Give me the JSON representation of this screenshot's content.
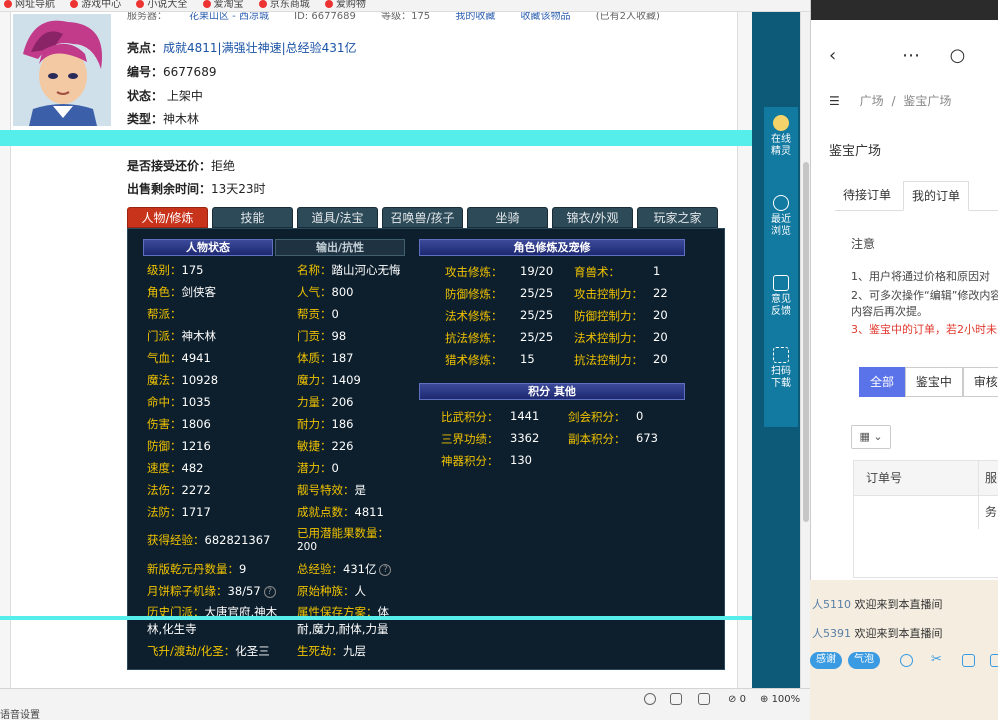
{
  "favbar": [
    "网址导航",
    "游戏中心",
    "小说大全",
    "爱淘宝",
    "京东商城",
    "爱购物"
  ],
  "subheader": {
    "left": "服务器：",
    "server": "花果山区 - 西凉城",
    "id_hint": "ID: 6677689",
    "level_hint": "等级：175",
    "link1": "我的收藏",
    "link2": "收藏该物品",
    "right": "(已有2人收藏)"
  },
  "info": {
    "highlight_label": "亮点：",
    "highlight_value": "成就4811|满强壮神速|总经验431亿",
    "id_label": "编号：",
    "id_value": "6677689",
    "status_label": "状态：",
    "status_value": "上架中",
    "type_label": "类型：",
    "type_value": "神木林",
    "bargain_label": "是否接受还价：",
    "bargain_value": "拒绝",
    "time_label": "出售剩余时间：",
    "time_value": "13天23时"
  },
  "tabs": [
    "人物/修炼",
    "技能",
    "道具/法宝",
    "召唤兽/孩子",
    "坐骑",
    "锦衣/外观",
    "玩家之家"
  ],
  "sections": {
    "char_status": "人物状态",
    "output": "输出/抗性",
    "cultivation": "角色修炼及宠修",
    "points": "积分 其他"
  },
  "left_stats": [
    {
      "k": "级别：",
      "v": "175"
    },
    {
      "k": "角色：",
      "v": "剑侠客"
    },
    {
      "k": "帮派：",
      "v": ""
    },
    {
      "k": "门派：",
      "v": "神木林"
    },
    {
      "k": "气血：",
      "v": "4941"
    },
    {
      "k": "魔法：",
      "v": "10928"
    },
    {
      "k": "命中：",
      "v": "1035"
    },
    {
      "k": "伤害：",
      "v": "1806"
    },
    {
      "k": "防御：",
      "v": "1216"
    },
    {
      "k": "速度：",
      "v": "482"
    },
    {
      "k": "法伤：",
      "v": "2272"
    },
    {
      "k": "法防：",
      "v": "1717"
    },
    {
      "k": "获得经验：",
      "v": "682821367"
    },
    {
      "k": "新版乾元丹数量：",
      "v": "9"
    },
    {
      "k": "月饼粽子机缘：",
      "v": "38/57"
    }
  ],
  "mid_stats": [
    {
      "k": "名称：",
      "v": "踏山河心无悔"
    },
    {
      "k": "人气：",
      "v": "800"
    },
    {
      "k": "帮贡：",
      "v": "0"
    },
    {
      "k": "门贡：",
      "v": "98"
    },
    {
      "k": "体质：",
      "v": "187"
    },
    {
      "k": "魔力：",
      "v": "1409"
    },
    {
      "k": "力量：",
      "v": "206"
    },
    {
      "k": "耐力：",
      "v": "186"
    },
    {
      "k": "敏捷：",
      "v": "226"
    },
    {
      "k": "潜力：",
      "v": "0"
    },
    {
      "k": "靓号特效：",
      "v": "是"
    },
    {
      "k": "成就点数：",
      "v": "4811"
    },
    {
      "k": "已用潜能果数量：",
      "v": "200"
    },
    {
      "k": "总经验：",
      "v": "431亿"
    },
    {
      "k": "原始种族：",
      "v": "人"
    }
  ],
  "history": {
    "k": "历史门派：",
    "v1": "大唐官府,神木",
    "v2": "林,化生寺"
  },
  "attr_keep": {
    "k": "属性保存方案：",
    "v1": "体",
    "v2": "耐,魔力,耐体,力量"
  },
  "ascend": {
    "k": "飞升/渡劫/化圣：",
    "v": "化圣三"
  },
  "lifedeath": {
    "k": "生死劫：",
    "v": "九层"
  },
  "cultivation": [
    {
      "k1": "攻击修炼：",
      "v1": "19/20",
      "k2": "育兽术：",
      "v2": "1"
    },
    {
      "k1": "防御修炼：",
      "v1": "25/25",
      "k2": "攻击控制力：",
      "v2": "22"
    },
    {
      "k1": "法术修炼：",
      "v1": "25/25",
      "k2": "防御控制力：",
      "v2": "20"
    },
    {
      "k1": "抗法修炼：",
      "v1": "25/25",
      "k2": "法术控制力：",
      "v2": "20"
    },
    {
      "k1": "猎术修炼：",
      "v1": "15",
      "k2": "抗法控制力：",
      "v2": "20"
    }
  ],
  "points": [
    {
      "k1": "比武积分：",
      "v1": "1441",
      "k2": "剑会积分：",
      "v2": "0"
    },
    {
      "k1": "三界功绩：",
      "v1": "3362",
      "k2": "副本积分：",
      "v2": "673"
    },
    {
      "k1": "神器积分：",
      "v1": "130",
      "k2": "",
      "v2": ""
    }
  ],
  "vbar": [
    {
      "l1": "在线",
      "l2": "精灵",
      "icon": "fairy-icon"
    },
    {
      "l1": "最近",
      "l2": "浏览",
      "icon": "clock-icon"
    },
    {
      "l1": "意见",
      "l2": "反馈",
      "icon": "feedback-icon"
    },
    {
      "l1": "扫码",
      "l2": "下载",
      "icon": "scan-icon"
    }
  ],
  "right_panel": {
    "crumb1": "广场",
    "crumb2": "鉴宝广场",
    "title": "鉴宝广场",
    "tab1": "待接订单",
    "tab2": "我的订单",
    "note_title": "注意",
    "note1": "1、用户将通过价格和原因对",
    "note2": "2、可多次操作“编辑”修改内容",
    "note3": "内容后再次提。",
    "note4": "3、鉴宝中的订单，若2小时未",
    "btn_all": "全部",
    "btn_appraising": "鉴宝中",
    "btn_review": "审核中",
    "grid_icon": "grid-icon",
    "col_order": "订单号",
    "col_service": "服务"
  },
  "chat": [
    {
      "user": "人5110",
      "text": "欢迎来到本直播间"
    },
    {
      "user": "人5391",
      "text": "欢迎来到本直播间"
    }
  ],
  "chat_tools": {
    "p1": "感谢",
    "p2": "气泡"
  },
  "status": {
    "zoom": "100%",
    "count": "0",
    "left": "语音设置"
  }
}
